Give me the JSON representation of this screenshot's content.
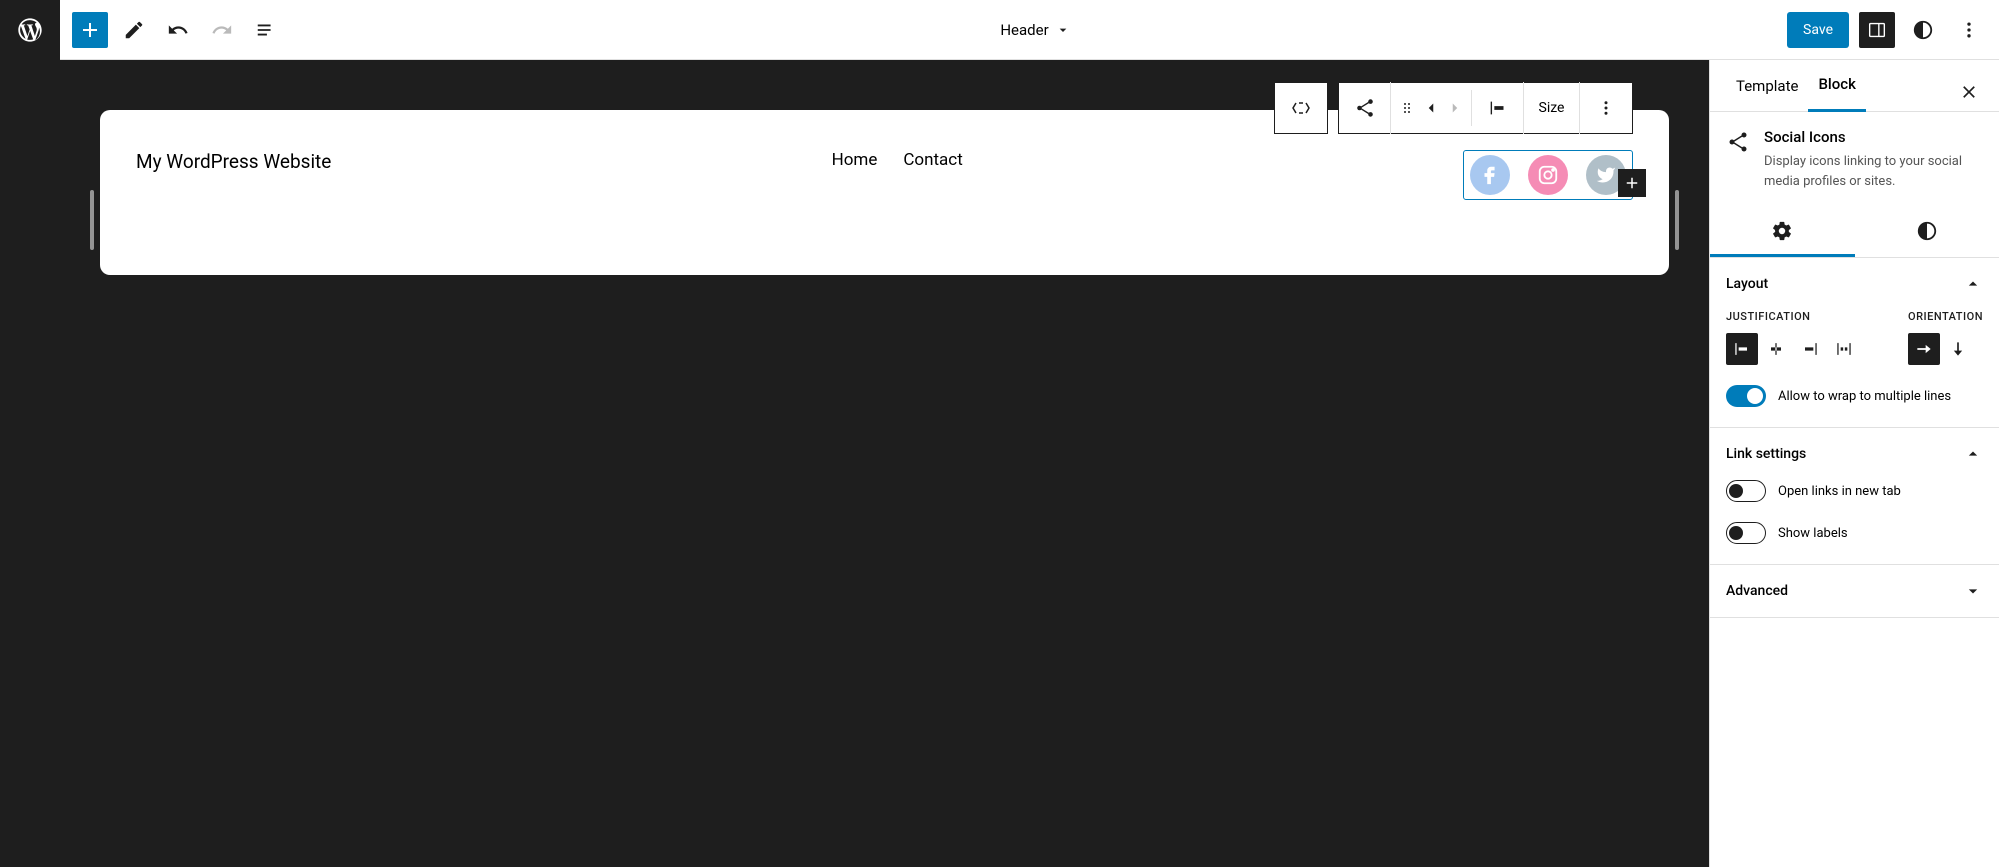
{
  "toolbar": {
    "document_title": "Header",
    "save_label": "Save"
  },
  "canvas": {
    "site_title": "My WordPress Website",
    "nav": [
      "Home",
      "Contact"
    ]
  },
  "block_toolbar": {
    "size_label": "Size"
  },
  "sidebar": {
    "tabs": {
      "template": "Template",
      "block": "Block"
    },
    "block_info": {
      "title": "Social Icons",
      "description": "Display icons linking to your social media profiles or sites."
    },
    "panels": {
      "layout": {
        "title": "Layout",
        "justification_label": "Justification",
        "orientation_label": "Orientation",
        "wrap_label": "Allow to wrap to multiple lines"
      },
      "link_settings": {
        "title": "Link settings",
        "new_tab_label": "Open links in new tab",
        "show_labels_label": "Show labels"
      },
      "advanced": {
        "title": "Advanced"
      }
    }
  }
}
